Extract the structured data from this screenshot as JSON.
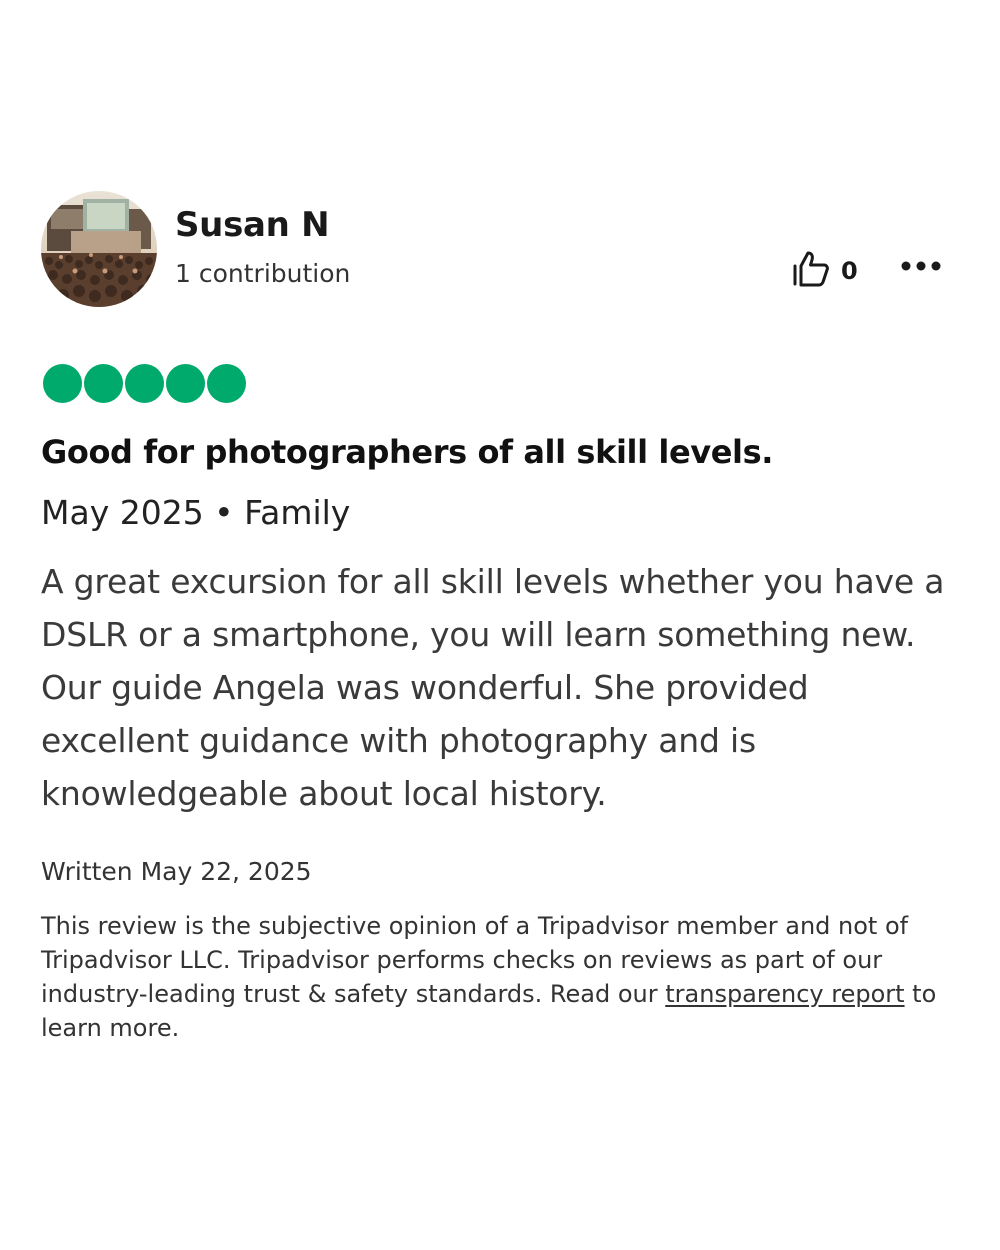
{
  "reviewer": {
    "name": "Susan N",
    "contributions": "1 contribution",
    "avatar_icon": "concert-crowd-avatar"
  },
  "actions": {
    "helpful_icon": "thumbs-up-icon",
    "helpful_count": "0",
    "more_icon": "more-options-icon"
  },
  "rating": {
    "value": 5,
    "max": 5,
    "color": "#00aa6c"
  },
  "review": {
    "title": "Good for photographers of all skill levels.",
    "visit": "May 2025 • Family",
    "body": "A great excursion for all skill levels whether you have a DSLR or a smartphone, you will learn something new. Our guide Angela was wonderful. She provided excellent guidance with photography and is knowledgeable about local history.",
    "written": "Written May 22, 2025"
  },
  "disclaimer": {
    "text_before": "This review is the subjective opinion of a Tripadvisor member and not of Tripadvisor LLC. Tripadvisor performs checks on reviews as part of our industry-leading trust & safety standards. Read our ",
    "link_label": "transparency report",
    "text_after": " to learn more."
  }
}
